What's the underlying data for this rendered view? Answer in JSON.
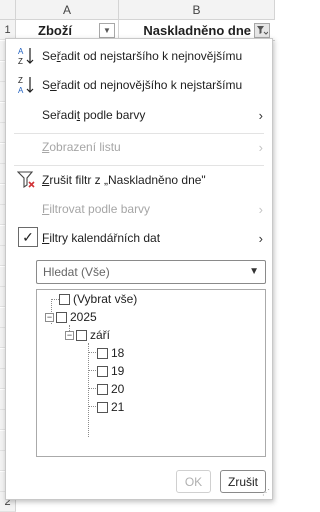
{
  "sheet": {
    "columns": [
      "A",
      "B"
    ],
    "row_numbers": [
      "1",
      "1",
      "2",
      "2",
      "2",
      "2",
      "2",
      "2",
      "2",
      "2",
      "2",
      "2",
      "2",
      "2",
      "2",
      "2",
      "2",
      "2",
      "2",
      "2",
      "2",
      "2",
      "2",
      "2"
    ],
    "headers": {
      "a": "Zboží",
      "b": "Naskladněno dne"
    }
  },
  "menu": {
    "sort_oldest": {
      "pre": "Se",
      "ul": "ř",
      "post": "adit od nejstaršího k nejnovějšímu"
    },
    "sort_newest": {
      "pre": "S",
      "ul": "e",
      "post": "řadit od nejnovějšího k nejstaršímu"
    },
    "sort_color": {
      "pre": "Seřadi",
      "ul": "t",
      "post": " podle barvy"
    },
    "sheet_view": {
      "pre": "",
      "ul": "Z",
      "post": "obrazení listu"
    },
    "clear_filter": {
      "pre": "",
      "ul": "Z",
      "post": "rušit filtr z „Naskladněno dne\""
    },
    "filter_color": {
      "pre": "",
      "ul": "F",
      "post": "iltrovat podle barvy"
    },
    "date_filters": {
      "pre": "",
      "ul": "F",
      "post": "iltry kalendářních dat"
    }
  },
  "search": {
    "placeholder": "Hledat (Vše)"
  },
  "tree": {
    "select_all": "(Vybrat vše)",
    "year": "2025",
    "month": "září",
    "days": [
      "18",
      "19",
      "20",
      "21"
    ]
  },
  "buttons": {
    "ok": "OK",
    "cancel": "Zrušit"
  },
  "icons": {
    "sort_asc": "sort-a-z-icon",
    "sort_desc": "sort-z-a-icon",
    "clear_filter": "funnel-x-icon",
    "filter_dropdown": "funnel-icon"
  },
  "colors": {
    "accent_blue": "#1f5fbf",
    "clear_red": "#d13438"
  }
}
